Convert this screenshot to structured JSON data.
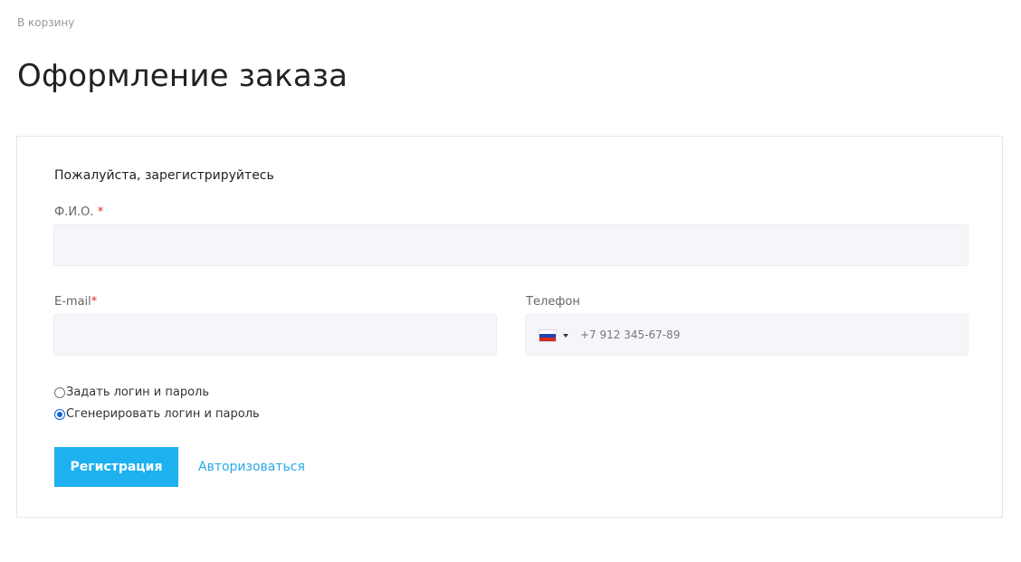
{
  "nav": {
    "back_link": "В корзину"
  },
  "page": {
    "title": "Оформление заказа"
  },
  "form": {
    "heading": "Пожалуйста, зарегистрируйтесь",
    "fio": {
      "label": "Ф.И.О.",
      "required_mark": "*",
      "value": ""
    },
    "email": {
      "label": "E-mail",
      "required_mark": "*",
      "value": ""
    },
    "phone": {
      "label": "Телефон",
      "country_flag": "russia-flag-icon",
      "placeholder": "+7 912 345-67-89",
      "value": ""
    },
    "login_options": [
      {
        "label": "Задать логин и пароль",
        "checked": false
      },
      {
        "label": "Сгенерировать логин и пароль",
        "checked": true
      }
    ],
    "register_button": "Регистрация",
    "auth_link": "Авторизоваться"
  },
  "colors": {
    "accent": "#1eb1f0",
    "link": "#2aa8e6",
    "required": "#e0292b",
    "input_bg": "#f6f6fa"
  }
}
